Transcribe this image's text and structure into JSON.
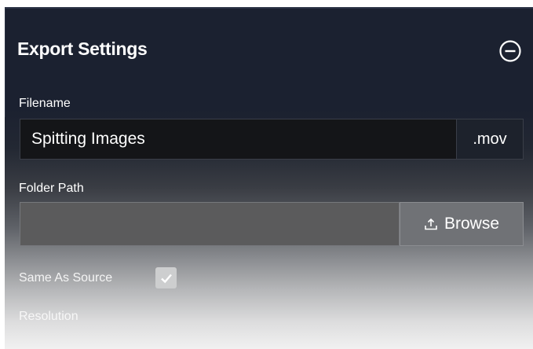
{
  "panel": {
    "title": "Export Settings",
    "collapse_icon": "minus-circle-icon"
  },
  "filename": {
    "label": "Filename",
    "value": "Spitting Images",
    "extension": ".mov"
  },
  "folder_path": {
    "label": "Folder Path",
    "value": "",
    "browse_label": "Browse",
    "browse_icon": "upload-icon"
  },
  "same_as_source": {
    "label": "Same As Source",
    "checked": true
  },
  "resolution": {
    "label": "Resolution"
  },
  "colors": {
    "panel_bg": "#1b2130",
    "input_bg": "#141518",
    "text": "#ffffff"
  }
}
